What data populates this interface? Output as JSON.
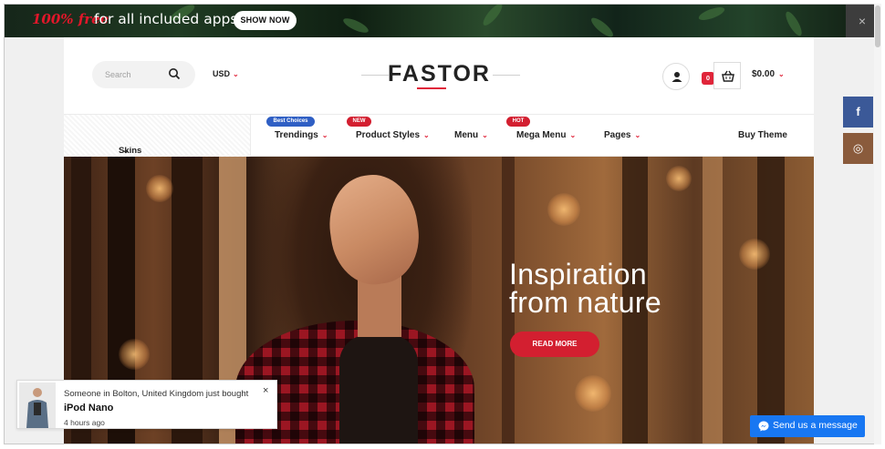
{
  "promo": {
    "highlight": "100% free",
    "text": "for all included apps",
    "button": "SHOW NOW",
    "close": "×"
  },
  "header": {
    "search_placeholder": "Search",
    "currency": "USD",
    "logo": "FASTOR",
    "cart_count": "0",
    "cart_total": "$0.00"
  },
  "nav": {
    "skins": "Skins List",
    "items": [
      {
        "label": "Trendings",
        "badge": "Best Choices",
        "badge_color": "#2f5fc4"
      },
      {
        "label": "Product Styles",
        "badge": "NEW",
        "badge_color": "#d31f30"
      },
      {
        "label": "Menu",
        "badge": "",
        "badge_color": ""
      },
      {
        "label": "Mega Menu",
        "badge": "HOT",
        "badge_color": "#d31f30"
      },
      {
        "label": "Pages",
        "badge": "",
        "badge_color": ""
      }
    ],
    "buy": "Buy Theme"
  },
  "hero": {
    "title": "Inspiration\nfrom nature",
    "button": "READ MORE"
  },
  "social": {
    "facebook": "f",
    "instagram": "◎"
  },
  "popup": {
    "line1": "Someone in Bolton, United Kingdom just bought",
    "product": "iPod Nano",
    "time": "4 hours ago",
    "close": "×"
  },
  "messenger": {
    "label": "Send us a message"
  },
  "colors": {
    "accent": "#d31f30",
    "facebook": "#3b5998",
    "messenger": "#1877f2"
  }
}
